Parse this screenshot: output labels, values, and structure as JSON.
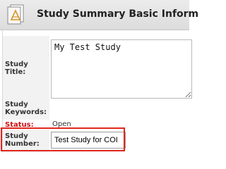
{
  "header": {
    "title": "Study Summary Basic Inform",
    "icon": "study-document-icon"
  },
  "form": {
    "study_title": {
      "label": "Study Title:",
      "value": "My Test Study"
    },
    "study_keywords": {
      "label": "Study Keywords:",
      "value": ""
    },
    "status": {
      "label": "Status:",
      "value": "Open",
      "label_color": "#cc1111"
    },
    "study_number": {
      "label": "Study Number:",
      "value": "Test Study for COI"
    }
  },
  "highlight": {
    "color": "#e1261c",
    "target": "study_number"
  }
}
